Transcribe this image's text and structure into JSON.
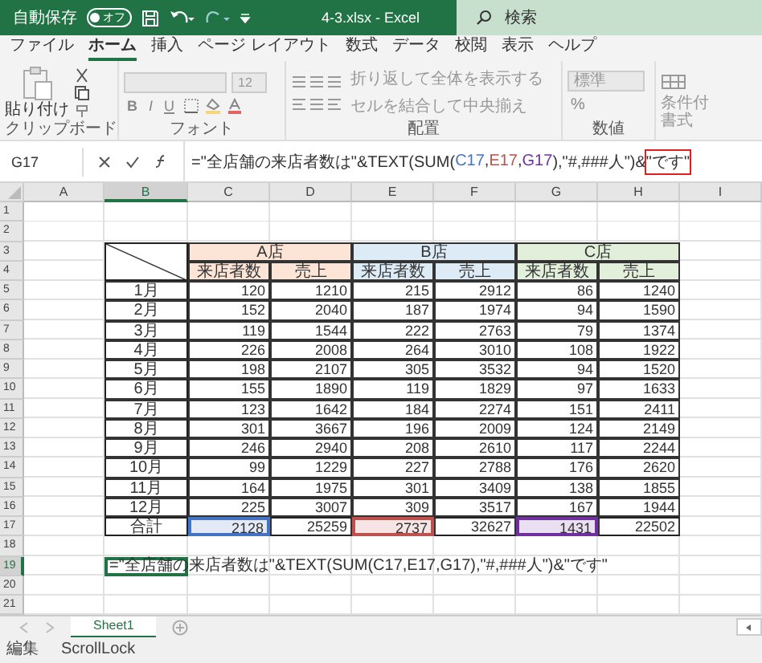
{
  "title_bar": {
    "autosave_label": "自動保存",
    "autosave_state": "オフ",
    "autosave_on": false,
    "file_title": "4-3.xlsx - Excel",
    "search_placeholder": "検索"
  },
  "tabs": [
    {
      "label": "ファイル",
      "selected": false
    },
    {
      "label": "ホーム",
      "selected": true
    },
    {
      "label": "挿入",
      "selected": false
    },
    {
      "label": "ページ レイアウト",
      "selected": false
    },
    {
      "label": "数式",
      "selected": false
    },
    {
      "label": "データ",
      "selected": false
    },
    {
      "label": "校閲",
      "selected": false
    },
    {
      "label": "表示",
      "selected": false
    },
    {
      "label": "ヘルプ",
      "selected": false
    }
  ],
  "ribbon": {
    "clipboard": {
      "paste": "貼り付け",
      "label": "クリップボード"
    },
    "font": {
      "size": "12",
      "bold": "B",
      "italic": "I",
      "underline": "U",
      "label": "フォント"
    },
    "alignment": {
      "wrap": "折り返して全体を表示する",
      "merge": "セルを結合して中央揃え",
      "label": "配置"
    },
    "number": {
      "format": "標準",
      "percent": "%",
      "label": "数値"
    },
    "styles": {
      "line1": "条件付",
      "line2": "書式"
    }
  },
  "formula_bar": {
    "name_box": "G17",
    "segments": [
      {
        "text": "=\"全店舗の来店者数は\"&TEXT(SUM(",
        "highlighted": false
      },
      {
        "text": "C17",
        "color": "#4472c4",
        "highlighted": false
      },
      {
        "text": ",",
        "highlighted": false
      },
      {
        "text": "E17",
        "color": "#c0504d",
        "highlighted": false
      },
      {
        "text": ",",
        "highlighted": false
      },
      {
        "text": "G17",
        "color": "#7030a0",
        "highlighted": false
      },
      {
        "text": "),\"#,###人\")&",
        "highlighted": false
      },
      {
        "text": "\"です\"",
        "highlighted": true
      }
    ]
  },
  "sheet": {
    "columns": [
      {
        "label": "A",
        "selected": false
      },
      {
        "label": "B",
        "selected": true
      },
      {
        "label": "C",
        "selected": false
      },
      {
        "label": "D",
        "selected": false
      },
      {
        "label": "E",
        "selected": false
      },
      {
        "label": "F",
        "selected": false
      },
      {
        "label": "G",
        "selected": false
      },
      {
        "label": "H",
        "selected": false
      },
      {
        "label": "I",
        "selected": false
      }
    ],
    "rows": [
      {
        "label": "1",
        "selected": false
      },
      {
        "label": "2",
        "selected": false
      },
      {
        "label": "3",
        "selected": false
      },
      {
        "label": "4",
        "selected": false
      },
      {
        "label": "5",
        "selected": false
      },
      {
        "label": "6",
        "selected": false
      },
      {
        "label": "7",
        "selected": false
      },
      {
        "label": "8",
        "selected": false
      },
      {
        "label": "9",
        "selected": false
      },
      {
        "label": "10",
        "selected": false
      },
      {
        "label": "11",
        "selected": false
      },
      {
        "label": "12",
        "selected": false
      },
      {
        "label": "13",
        "selected": false
      },
      {
        "label": "14",
        "selected": false
      },
      {
        "label": "15",
        "selected": false
      },
      {
        "label": "16",
        "selected": false
      },
      {
        "label": "17",
        "selected": false
      },
      {
        "label": "18",
        "selected": false
      },
      {
        "label": "19",
        "selected": true
      },
      {
        "label": "20",
        "selected": false
      },
      {
        "label": "21",
        "selected": false
      }
    ],
    "stores": [
      {
        "name": "A店",
        "color": "#fce4d6"
      },
      {
        "name": "B店",
        "color": "#ddebf7"
      },
      {
        "name": "C店",
        "color": "#e2efda"
      }
    ],
    "subheaders": [
      "来店者数",
      "売上",
      "来店者数",
      "売上",
      "来店者数",
      "売上"
    ],
    "months": [
      {
        "label": "1月",
        "values": [
          "120",
          "1210",
          "215",
          "2912",
          "86",
          "1240"
        ]
      },
      {
        "label": "2月",
        "values": [
          "152",
          "2040",
          "187",
          "1974",
          "94",
          "1590"
        ]
      },
      {
        "label": "3月",
        "values": [
          "119",
          "1544",
          "222",
          "2763",
          "79",
          "1374"
        ]
      },
      {
        "label": "4月",
        "values": [
          "226",
          "2008",
          "264",
          "3010",
          "108",
          "1922"
        ]
      },
      {
        "label": "5月",
        "values": [
          "198",
          "2107",
          "305",
          "3532",
          "94",
          "1520"
        ]
      },
      {
        "label": "6月",
        "values": [
          "155",
          "1890",
          "119",
          "1829",
          "97",
          "1633"
        ]
      },
      {
        "label": "7月",
        "values": [
          "123",
          "1642",
          "184",
          "2274",
          "151",
          "2411"
        ]
      },
      {
        "label": "8月",
        "values": [
          "301",
          "3667",
          "196",
          "2009",
          "124",
          "2149"
        ]
      },
      {
        "label": "9月",
        "values": [
          "246",
          "2940",
          "208",
          "2610",
          "117",
          "2244"
        ]
      },
      {
        "label": "10月",
        "values": [
          "99",
          "1229",
          "227",
          "2788",
          "176",
          "2620"
        ]
      },
      {
        "label": "11月",
        "values": [
          "164",
          "1975",
          "301",
          "3409",
          "138",
          "1855"
        ]
      },
      {
        "label": "12月",
        "values": [
          "225",
          "3007",
          "309",
          "3517",
          "167",
          "1944"
        ]
      }
    ],
    "total": {
      "label": "合計",
      "values": [
        {
          "text": "2128",
          "color": "#4472c4"
        },
        {
          "text": "25259"
        },
        {
          "text": "2737",
          "color": "#c0504d"
        },
        {
          "text": "32627"
        },
        {
          "text": "1431",
          "color": "#7030a0"
        },
        {
          "text": "22502"
        }
      ]
    },
    "formula_cell": {
      "text": "=\"全店舗の来店者数は\"&TEXT(SUM(C17,E17,G17),\"#,###人\")&\"です\"",
      "active": true
    }
  },
  "sheet_tabs": [
    {
      "label": "Sheet1",
      "selected": true
    }
  ],
  "status_bar": [
    "編集",
    "ScrollLock"
  ]
}
